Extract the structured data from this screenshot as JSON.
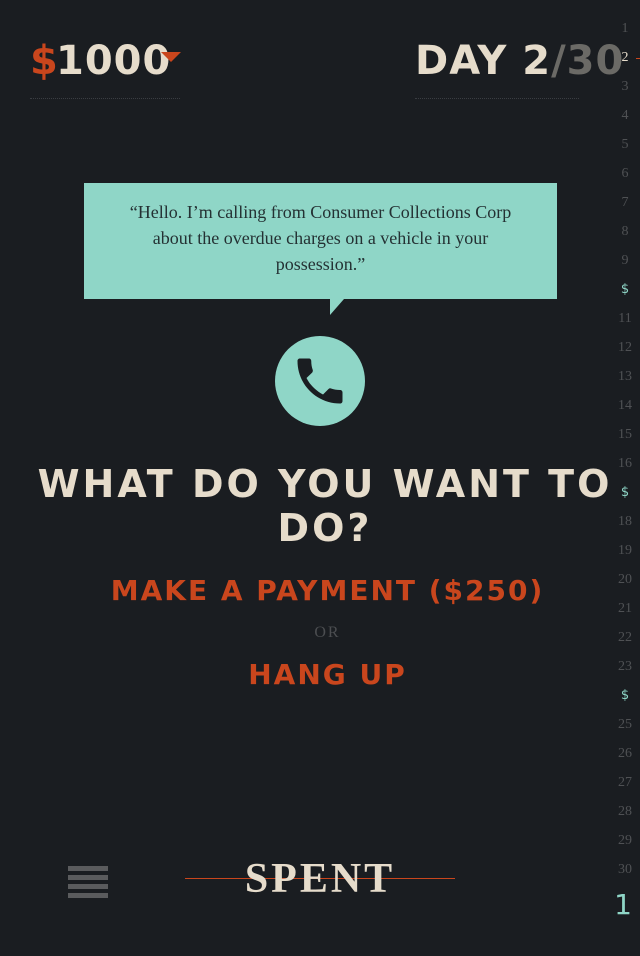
{
  "header": {
    "currency_symbol": "$",
    "balance": "1000",
    "day_label": "DAY 2",
    "day_sep": "/",
    "day_total": "30"
  },
  "dialog": {
    "quote": "“Hello. I’m calling from Consumer Collections Corp about the overdue charges on a vehicle in your possession.”"
  },
  "prompt": {
    "question": "WHAT DO YOU WANT TO DO?",
    "option_1": "MAKE A PAYMENT ($250)",
    "or": "OR",
    "option_2": "HANG UP"
  },
  "footer": {
    "logo": "SPENT"
  },
  "day_rail": {
    "items": [
      "1",
      "2",
      "3",
      "4",
      "5",
      "6",
      "7",
      "8",
      "9",
      "$",
      "11",
      "12",
      "13",
      "14",
      "15",
      "16",
      "$",
      "18",
      "19",
      "20",
      "21",
      "22",
      "23",
      "$",
      "25",
      "26",
      "27",
      "28",
      "29",
      "30"
    ],
    "current_index": 1,
    "big_value": "1"
  },
  "colors": {
    "background": "#1a1d21",
    "accent_orange": "#c9461d",
    "accent_teal": "#8fd6c7",
    "cream": "#e6dccb"
  }
}
